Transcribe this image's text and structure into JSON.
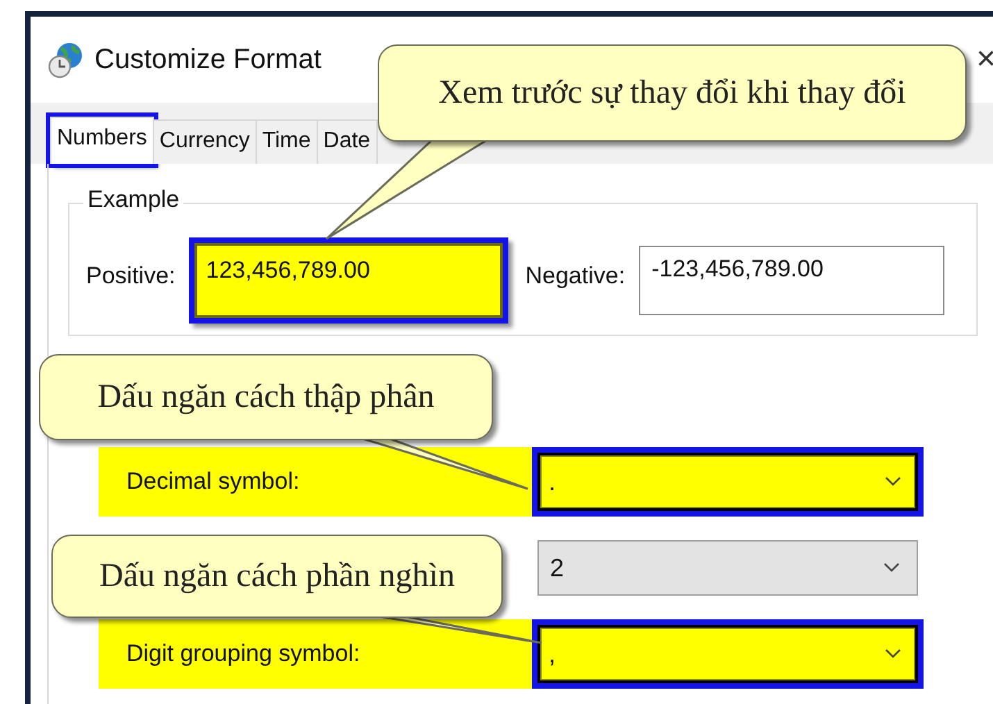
{
  "window": {
    "title": "Customize Format",
    "close": "×"
  },
  "tabs": [
    {
      "label": "Numbers",
      "selected": true,
      "highlighted": true
    },
    {
      "label": "Currency",
      "selected": false,
      "highlighted": false
    },
    {
      "label": "Time",
      "selected": false,
      "highlighted": false
    },
    {
      "label": "Date",
      "selected": false,
      "highlighted": false
    }
  ],
  "example": {
    "title": "Example",
    "fields": [
      {
        "label": "Positive:",
        "value": "123,456,789.00",
        "highlighted": true
      },
      {
        "label": "Negative:",
        "value": "-123,456,789.00",
        "highlighted": false
      }
    ]
  },
  "settings": [
    {
      "label": "Decimal symbol:",
      "value": ".",
      "highlighted": true
    },
    {
      "value": "2",
      "highlighted": false
    },
    {
      "label": "Digit grouping symbol:",
      "value": ",",
      "highlighted": true
    }
  ],
  "callouts": [
    {
      "text": "Xem trước sự thay đổi khi thay đổi"
    },
    {
      "text": "Dấu ngăn cách thập phân"
    },
    {
      "text": "Dấu ngăn cách phần nghìn"
    }
  ]
}
